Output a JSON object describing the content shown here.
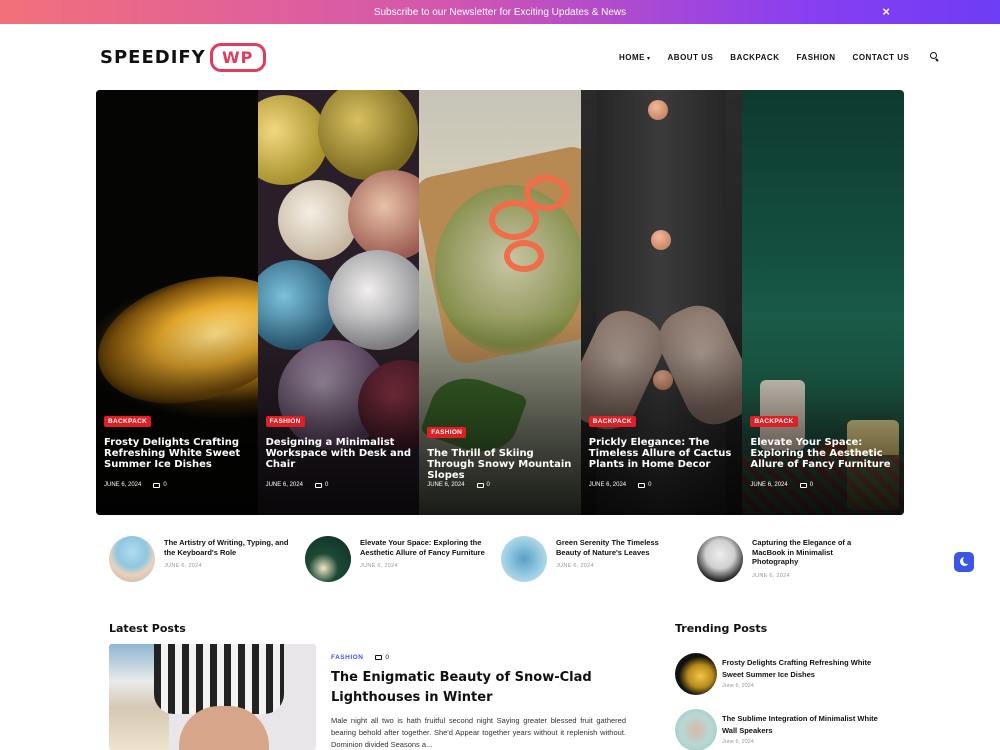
{
  "banner": {
    "text": "Subscribe to our Newsletter for Exciting Updates & News",
    "close": "×"
  },
  "logo": {
    "word": "SPEEDIFY",
    "badge": "WP"
  },
  "nav": {
    "items": [
      "HOME",
      "ABOUT US",
      "BACKPACK",
      "FASHION",
      "CONTACT US"
    ],
    "caret": "▾"
  },
  "slides": [
    {
      "category": "BACKPACK",
      "title": "Frosty Delights Crafting Refreshing White Sweet Summer Ice Dishes",
      "date": "JUNE 6, 2024",
      "comments": "0"
    },
    {
      "category": "FASHION",
      "title": "Designing a Minimalist Workspace with Desk and Chair",
      "date": "JUNE 6, 2024",
      "comments": "0"
    },
    {
      "category": "FASHION",
      "title": "The Thrill of Skiing Through Snowy Mountain Slopes",
      "date": "JUNE 6, 2024",
      "comments": "0"
    },
    {
      "category": "BACKPACK",
      "title": "Prickly Elegance: The Timeless Allure of Cactus Plants in Home Decor",
      "date": "JUNE 6, 2024",
      "comments": "0"
    },
    {
      "category": "BACKPACK",
      "title": "Elevate Your Space: Exploring the Aesthetic Allure of Fancy Furniture",
      "date": "JUNE 6, 2024",
      "comments": "0"
    }
  ],
  "mini_posts": [
    {
      "title": "The Artistry of Writing, Typing, and the Keyboard's Role",
      "date": "JUNE 6, 2024"
    },
    {
      "title": "Elevate Your Space: Exploring the Aesthetic Allure of Fancy Furniture",
      "date": "JUNE 6, 2024"
    },
    {
      "title": "Green Serenity The Timeless Beauty of Nature's Leaves",
      "date": "JUNE 6, 2024"
    },
    {
      "title": "Capturing the Elegance of a MacBook in Minimalist Photography",
      "date": "JUNE 6, 2024"
    }
  ],
  "latest": {
    "heading": "Latest Posts",
    "category": "FASHION",
    "comments": "0",
    "title": "The Enigmatic Beauty of Snow-Clad Lighthouses in Winter",
    "excerpt": "Male night all two is hath fruitful second night Saying greater blessed fruit gathered bearing behold after together. She'd Appear together years without it replenish without. Dominion divided Seasons a..."
  },
  "trending": {
    "heading": "Trending Posts",
    "items": [
      {
        "title": "Frosty Delights Crafting Refreshing White Sweet Summer Ice Dishes",
        "date": "June 6, 2024"
      },
      {
        "title": "The Sublime Integration of Minimalist White Wall Speakers",
        "date": "June 6, 2024"
      }
    ]
  },
  "colors": {
    "accent": "#e01e24",
    "brand": "#e23b5b",
    "link": "#3b55e6"
  }
}
